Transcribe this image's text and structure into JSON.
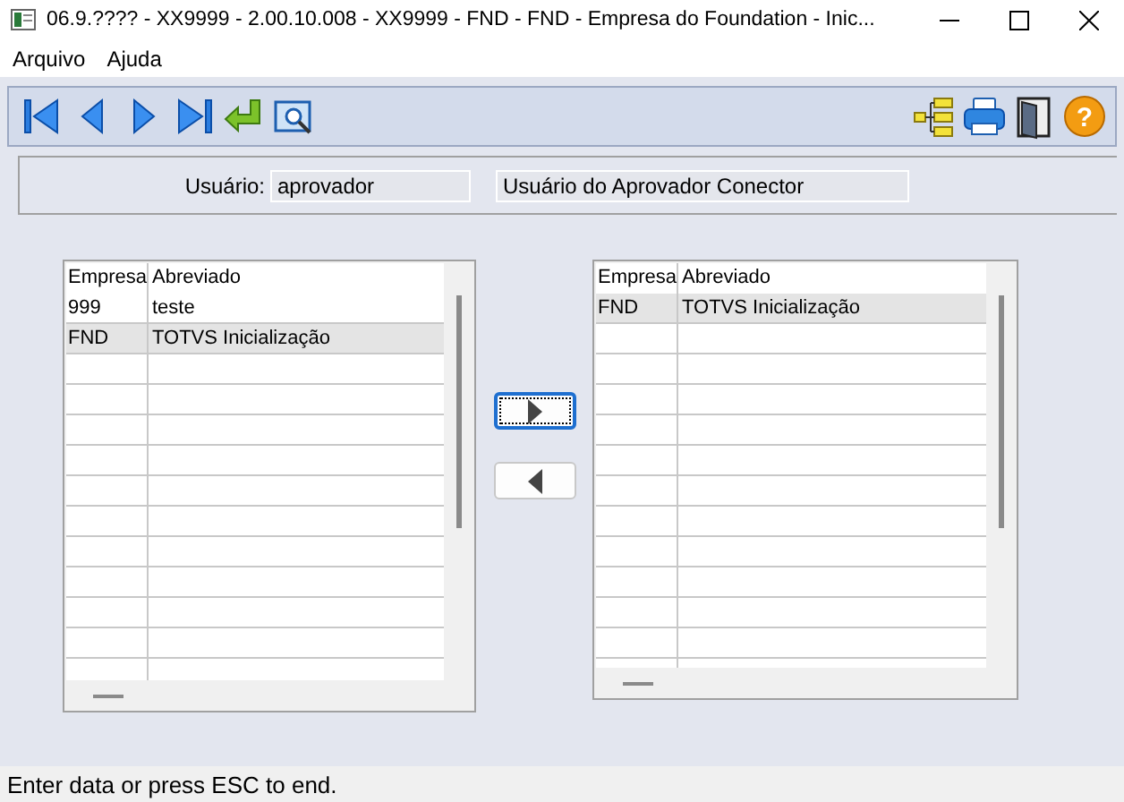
{
  "window": {
    "title": "06.9.???? - XX9999 - 2.00.10.008 - XX9999 - FND - FND - Empresa do Foundation - Inic..."
  },
  "menu": [
    {
      "label": "Arquivo"
    },
    {
      "label": "Ajuda"
    }
  ],
  "toolbar": {
    "left": [
      {
        "kind": "first"
      },
      {
        "kind": "prev"
      },
      {
        "kind": "next"
      },
      {
        "kind": "last"
      },
      {
        "kind": "confirm"
      },
      {
        "kind": "preview"
      }
    ],
    "right": [
      {
        "kind": "tree"
      },
      {
        "kind": "print"
      },
      {
        "kind": "exit"
      },
      {
        "kind": "help",
        "label": "?"
      }
    ]
  },
  "user": {
    "label": "Usuário:",
    "value": "aprovador",
    "description": "Usuário do Aprovador Conector"
  },
  "lists": [
    {
      "columns": [
        "Empresa",
        "Abreviado"
      ],
      "rows": [
        {
          "cells": [
            "999",
            "teste"
          ],
          "selected": false
        },
        {
          "cells": [
            "FND",
            "TOTVS Inicialização"
          ],
          "selected": true
        }
      ]
    },
    {
      "columns": [
        "Empresa",
        "Abreviado"
      ],
      "rows": [
        {
          "cells": [
            "FND",
            "TOTVS Inicialização"
          ],
          "selected": true
        }
      ]
    }
  ],
  "transfer_buttons": [
    {
      "kind": "add",
      "focused": true
    },
    {
      "kind": "remove",
      "focused": false
    }
  ],
  "status_bar": {
    "text": "Enter data or press ESC to end."
  }
}
